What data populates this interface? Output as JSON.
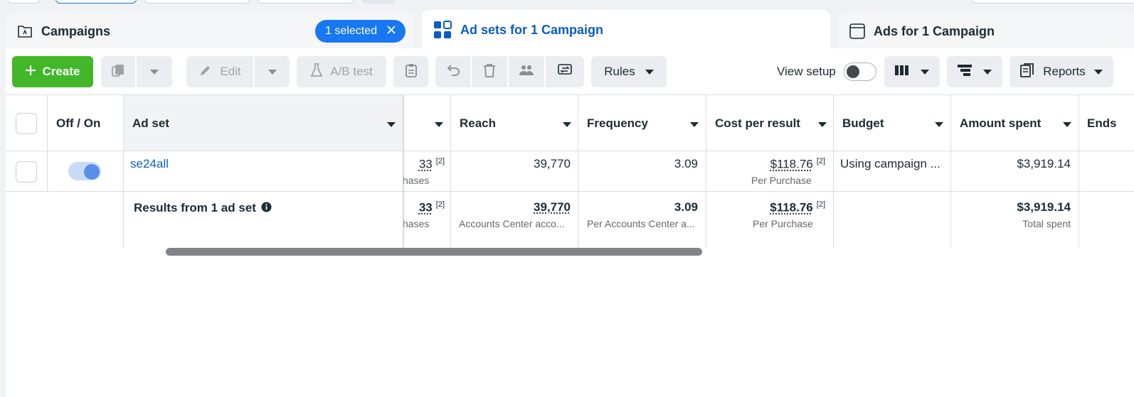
{
  "tabs": {
    "campaigns": "Campaigns",
    "selected_badge": "1 selected",
    "adsets": "Ad sets for 1 Campaign",
    "ads": "Ads for 1 Campaign"
  },
  "toolbar": {
    "create": "Create",
    "edit": "Edit",
    "ab_test": "A/B test",
    "rules": "Rules",
    "view_setup": "View setup",
    "reports": "Reports"
  },
  "table": {
    "headers": {
      "off_on": "Off / On",
      "ad_set": "Ad set",
      "reach": "Reach",
      "frequency": "Frequency",
      "cost_per_result": "Cost per result",
      "budget": "Budget",
      "amount_spent": "Amount spent",
      "ends": "Ends"
    },
    "row": {
      "name": "se24all",
      "results": "33",
      "results_note": "[2]",
      "results_sub": "hases",
      "reach": "39,770",
      "frequency": "3.09",
      "cost": "$118.76",
      "cost_note": "[2]",
      "cost_sub": "Per Purchase",
      "budget": "Using campaign ...",
      "spent": "$3,919.14"
    },
    "summary": {
      "label": "Results from 1 ad set",
      "results": "33",
      "results_note": "[2]",
      "results_sub": "hases",
      "reach": "39,770",
      "reach_sub": "Accounts Center acco...",
      "frequency": "3.09",
      "frequency_sub": "Per Accounts Center a...",
      "cost": "$118.76",
      "cost_note": "[2]",
      "cost_sub": "Per Purchase",
      "spent": "$3,919.14",
      "spent_sub": "Total spent"
    }
  },
  "colors": {
    "accent": "#1877f2",
    "create": "#42b72a",
    "link": "#0a5dc2"
  }
}
